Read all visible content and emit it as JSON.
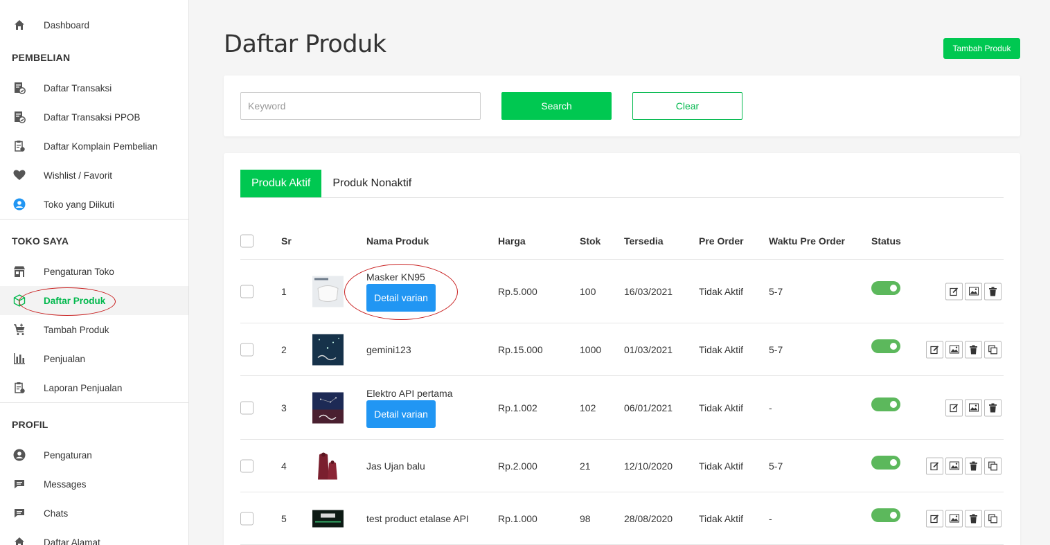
{
  "sidebar": {
    "dashboard": "Dashboard",
    "section_pembelian": "PEMBELIAN",
    "pembelian_items": [
      "Daftar Transaksi",
      "Daftar Transaksi PPOB",
      "Daftar Komplain Pembelian",
      "Wishlist / Favorit",
      "Toko yang Diikuti"
    ],
    "section_toko": "TOKO SAYA",
    "toko_items": [
      "Pengaturan Toko",
      "Daftar Produk",
      "Tambah Produk",
      "Penjualan",
      "Laporan Penjualan"
    ],
    "section_profil": "PROFIL",
    "profil_items": [
      "Pengaturan",
      "Messages",
      "Chats",
      "Daftar Alamat"
    ]
  },
  "page": {
    "title": "Daftar Produk",
    "add_button": "Tambah Produk"
  },
  "search": {
    "placeholder": "Keyword",
    "value": "",
    "search_label": "Search",
    "clear_label": "Clear"
  },
  "tabs": [
    "Produk Aktif",
    "Produk Nonaktif"
  ],
  "table": {
    "headers": {
      "sr": "Sr",
      "nama": "Nama Produk",
      "harga": "Harga",
      "stok": "Stok",
      "tersedia": "Tersedia",
      "pre_order": "Pre Order",
      "waktu": "Waktu Pre Order",
      "status": "Status"
    },
    "variant_label": "Detail varian",
    "rows": [
      {
        "sr": "1",
        "nama": "Masker KN95",
        "harga": "Rp.5.000",
        "stok": "100",
        "tersedia": "16/03/2021",
        "pre_order": "Tidak Aktif",
        "waktu": "5-7"
      },
      {
        "sr": "2",
        "nama": "gemini123",
        "harga": "Rp.15.000",
        "stok": "1000",
        "tersedia": "01/03/2021",
        "pre_order": "Tidak Aktif",
        "waktu": "5-7"
      },
      {
        "sr": "3",
        "nama": "Elektro API pertama",
        "harga": "Rp.1.002",
        "stok": "102",
        "tersedia": "06/01/2021",
        "pre_order": "Tidak Aktif",
        "waktu": "-"
      },
      {
        "sr": "4",
        "nama": "Jas Ujan balu",
        "harga": "Rp.2.000",
        "stok": "21",
        "tersedia": "12/10/2020",
        "pre_order": "Tidak Aktif",
        "waktu": "5-7"
      },
      {
        "sr": "5",
        "nama": "test product etalase API",
        "harga": "Rp.1.000",
        "stok": "98",
        "tersedia": "28/08/2020",
        "pre_order": "Tidak Aktif",
        "waktu": "-"
      }
    ]
  },
  "colors": {
    "brand_green": "#00c851",
    "variant_blue": "#2196f3",
    "toggle_green": "#5cb85c",
    "annotation_red": "#c81e1e"
  }
}
